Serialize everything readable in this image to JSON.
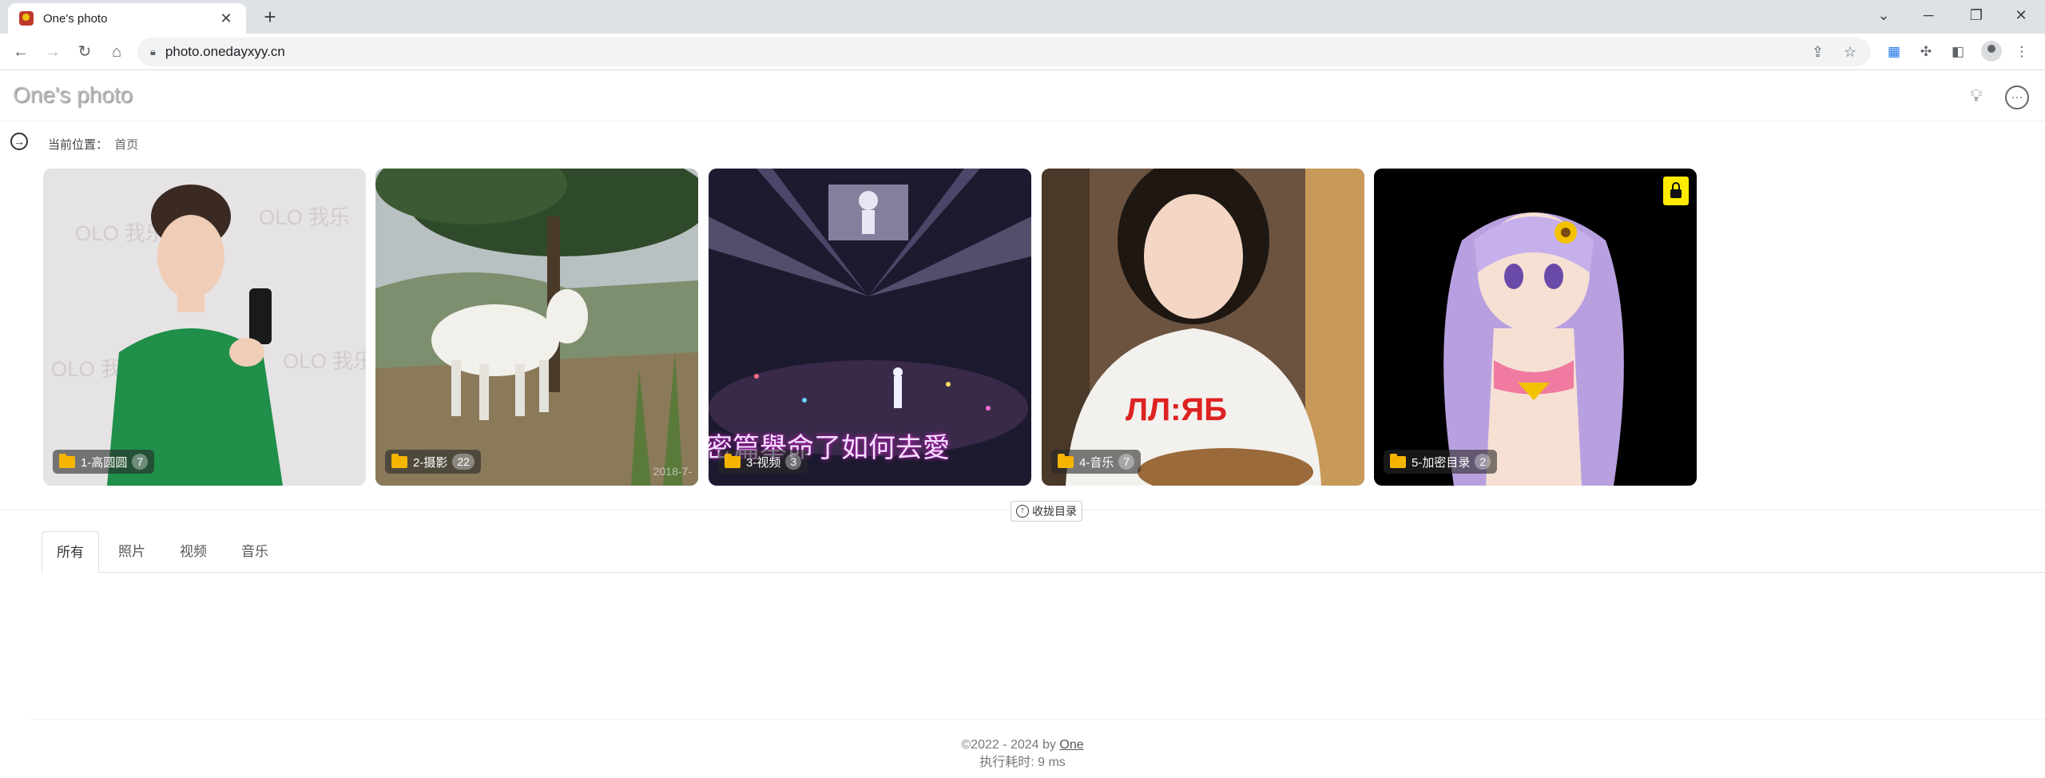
{
  "browser": {
    "tab_title": "One's photo",
    "url": "photo.onedayxyy.cn"
  },
  "header": {
    "logo": "One's photo",
    "icons": [
      "lightbulb-icon",
      "chat-icon"
    ]
  },
  "breadcrumb": {
    "prefix": "当前位置：",
    "home": "首页"
  },
  "albums": [
    {
      "label": "1-高圆圆",
      "count": "7"
    },
    {
      "label": "2-摄影",
      "count": "22",
      "watermark": "2018-7-"
    },
    {
      "label": "3-视频",
      "count": "3",
      "subtitle": "密篇舉命了如何去愛"
    },
    {
      "label": "4-音乐",
      "count": "7"
    },
    {
      "label": "5-加密目录",
      "count": "2",
      "locked": true
    }
  ],
  "collapse_label": "收拢目录",
  "tabs": [
    "所有",
    "照片",
    "视频",
    "音乐"
  ],
  "footer": {
    "copyright": "©2022 - 2024 by",
    "author": "One",
    "timing": "执行耗时: 9 ms"
  },
  "colors": {
    "lock_badge": "#ffeb00",
    "folder": "#f4b400"
  }
}
